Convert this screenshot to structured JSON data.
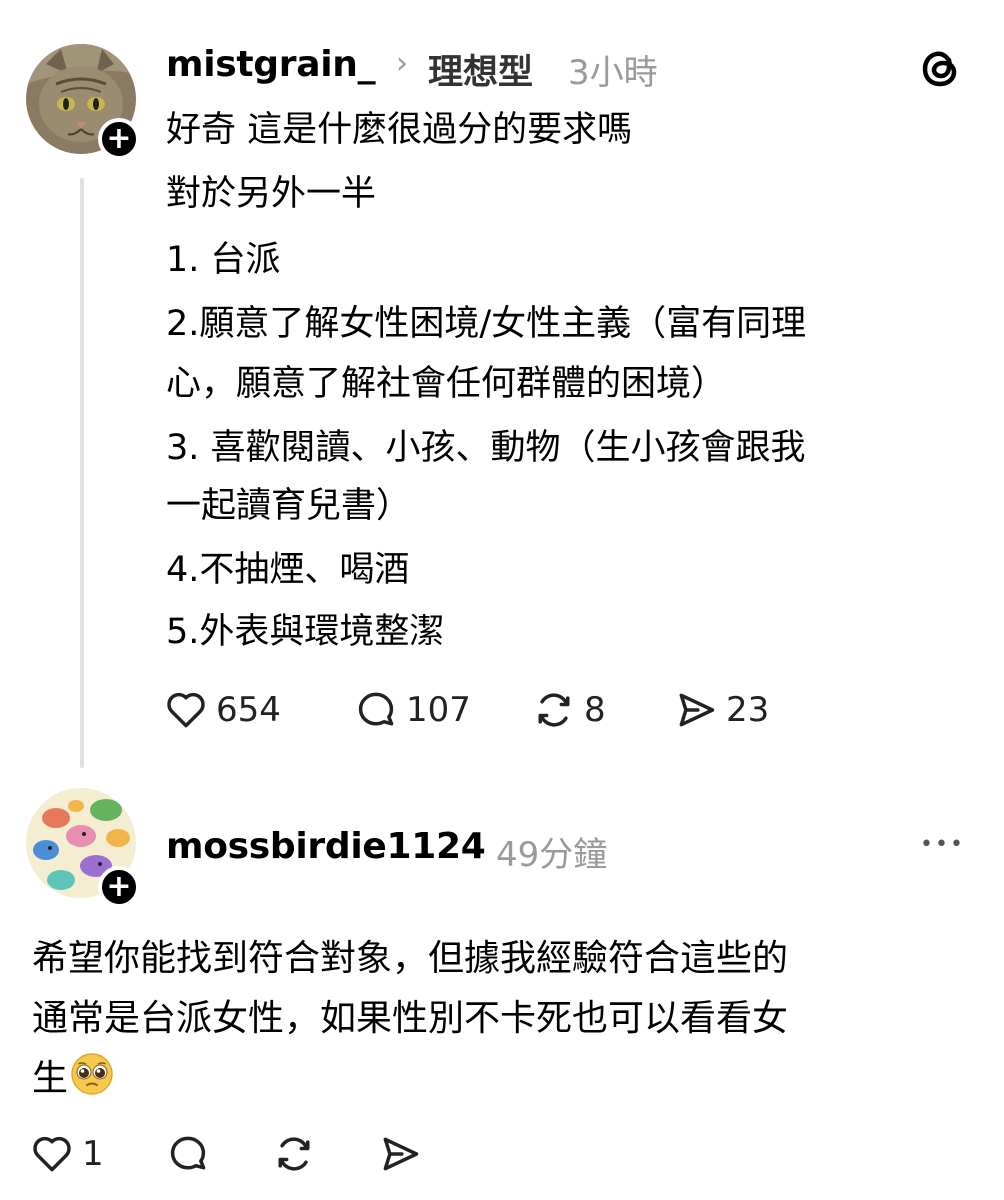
{
  "post": {
    "username": "mistgrain_",
    "chevron": "›",
    "topic": "理想型",
    "time": "3小時",
    "lines": [
      "好奇 這是什麼很過分的要求嗎",
      "對於另外一半",
      "1. 台派",
      "2.願意了解女性困境/女性主義（富有同理",
      "心，願意了解社會任何群體的困境）",
      "3. 喜歡閱讀、小孩、動物（生小孩會跟我",
      "一起讀育兒書）",
      "4.不抽煙、喝酒",
      "5.外表與環境整潔"
    ],
    "actions": {
      "likes": "654",
      "replies": "107",
      "reposts": "8",
      "shares": "23"
    },
    "follow_symbol": "+"
  },
  "reply": {
    "username": "mossbirdie1124",
    "time": "49分鐘",
    "more_symbol": "•••",
    "lines": [
      "希望你能找到符合對象，但據我經驗符合這些的",
      "通常是台派女性，如果性別不卡死也可以看看女",
      "生"
    ],
    "emoji": "🥺",
    "actions": {
      "likes": "1"
    },
    "follow_symbol": "+"
  },
  "icons": [
    "threads-logo-icon",
    "heart-icon",
    "comment-icon",
    "repost-icon",
    "share-icon",
    "more-icon"
  ]
}
